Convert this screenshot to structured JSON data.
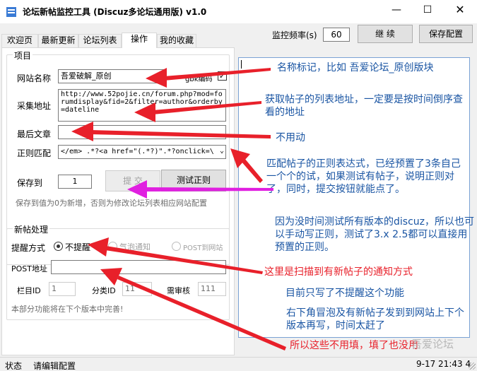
{
  "window": {
    "title": "论坛新帖监控工具 (Discuz多论坛通用版) v1.0",
    "min_glyph": "—",
    "max_glyph": "☐",
    "close_glyph": "✕"
  },
  "tabs": [
    "欢迎页",
    "最新更新",
    "论坛列表",
    "操作",
    "我的收藏"
  ],
  "active_tab": "操作",
  "toolbar": {
    "freq_label": "监控频率(s)",
    "freq_value": "60",
    "continue_label": "继 续",
    "save_label": "保存配置"
  },
  "project": {
    "group_title": "项目",
    "site_name_label": "网站名称",
    "site_name_value": "吾爱破解_原创",
    "gbk_label": "gbk编码",
    "gbk_checked": true,
    "collect_url_label": "采集地址",
    "collect_url_value": "http://www.52pojie.cn/forum.php?mod=forumdisplay&fid=2&filter=author&orderby=dateline",
    "last_article_label": "最后文章",
    "last_article_value": "",
    "regex_label": "正则匹配",
    "regex_value": "</em> .*?<a href=\"(.*?)\".*?onclick=\\",
    "save_to_label": "保存到",
    "save_to_value": "1",
    "submit_label": "提 交",
    "test_regex_label": "测试正则",
    "save_note": "保存到值为0为新增，否则为修改论坛列表相应网站配置"
  },
  "new_post": {
    "group_title": "新帖处理",
    "remind_label": "提醒方式",
    "options": [
      "不提醒",
      "气泡通知",
      "POST到网站"
    ],
    "selected_option": "不提醒",
    "post_url_label": "POST地址",
    "post_url_value": "",
    "column_id_label": "栏目ID",
    "column_id_value": "1",
    "category_id_label": "分类ID",
    "category_id_value": "11",
    "review_label": "需审核",
    "review_value": "111",
    "footer_note": "本部分功能将在下个版本中完善!"
  },
  "annotations": {
    "a1": "名称标记，比如 吾爱论坛_原创版块",
    "a2": "获取帖子的列表地址，一定要是按时间倒序查看的地址",
    "a3": "不用动",
    "a4": "匹配帖子的正则表达式，已经预置了3条自己一个个的试，如果测试有帖子，说明正则对了，同时，提交按钮就能点了。",
    "a5": "因为没时间测试所有版本的discuz，所以也可以手动写正则，测试了3.x 2.5都可以直接用预置的正则。",
    "a6": "这里是扫描到有新帖子的通知方式",
    "a7": "目前只写了不提醒这个功能",
    "a8": "右下角冒泡及有新帖子发到到网站上下个版本再写，时间太赶了",
    "a9": "所以这些不用填，填了也没用"
  },
  "status_bar": {
    "status_label": "状态",
    "status_text": "请编辑配置",
    "time": "9-17 21:43 4"
  },
  "watermark": "吾爱论坛",
  "colors": {
    "annotation_blue": "#1a55a3",
    "arrow_red": "#e8202a",
    "arrow_magenta": "#e020e0",
    "textbox_border": "#7aa2d4"
  }
}
